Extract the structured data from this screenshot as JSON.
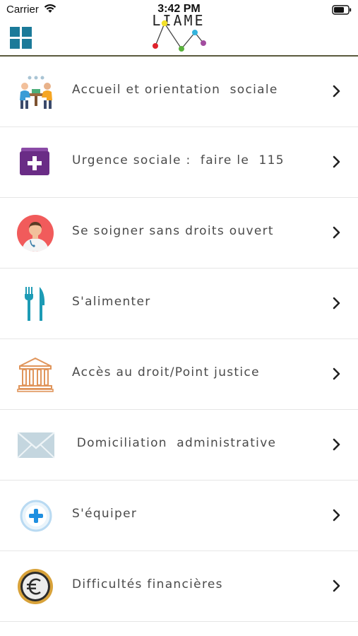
{
  "status_bar": {
    "carrier": "Carrier",
    "time": "3:42 PM"
  },
  "header": {
    "logo_text": "LIAME",
    "menu_icon": "grid-icon"
  },
  "menu": [
    {
      "label": "Accueil et orientation  sociale",
      "icon": "meeting-people-icon"
    },
    {
      "label": "Urgence sociale :  faire le  115",
      "icon": "medical-kit-icon"
    },
    {
      "label": "Se soigner sans droits ouvert",
      "icon": "doctor-icon"
    },
    {
      "label": "S'alimenter",
      "icon": "fork-knife-icon"
    },
    {
      "label": "Accès au droit/Point justice",
      "icon": "courthouse-icon"
    },
    {
      "label": " Domiciliation  administrative",
      "icon": "envelope-icon"
    },
    {
      "label": "S'équiper",
      "icon": "plus-circle-icon"
    },
    {
      "label": "Difficultés financières",
      "icon": "euro-coin-icon"
    }
  ],
  "colors": {
    "accent": "#1b7a99",
    "header_border": "#5b5a3e",
    "purple": "#6a2c86",
    "teal": "#1d9bb5",
    "coral": "#f15b5b",
    "gold": "#d8a23a"
  }
}
